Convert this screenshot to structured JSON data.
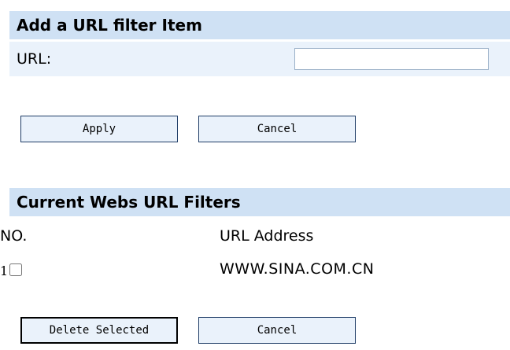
{
  "add_section": {
    "title": "Add a URL filter Item",
    "url_label": "URL:",
    "url_value": "",
    "apply_label": "Apply",
    "cancel_label": "Cancel"
  },
  "current_section": {
    "title": "Current Webs URL Filters",
    "columns": {
      "no": "NO.",
      "url": "URL Address"
    },
    "rows": [
      {
        "no": "1",
        "checked": false,
        "url": "WWW.SINA.COM.CN"
      }
    ],
    "delete_label": "Delete Selected",
    "cancel_label": "Cancel"
  },
  "colors": {
    "header_bg": "#cfe1f4",
    "row_bg": "#eaf2fb",
    "button_border": "#1e3c66"
  }
}
